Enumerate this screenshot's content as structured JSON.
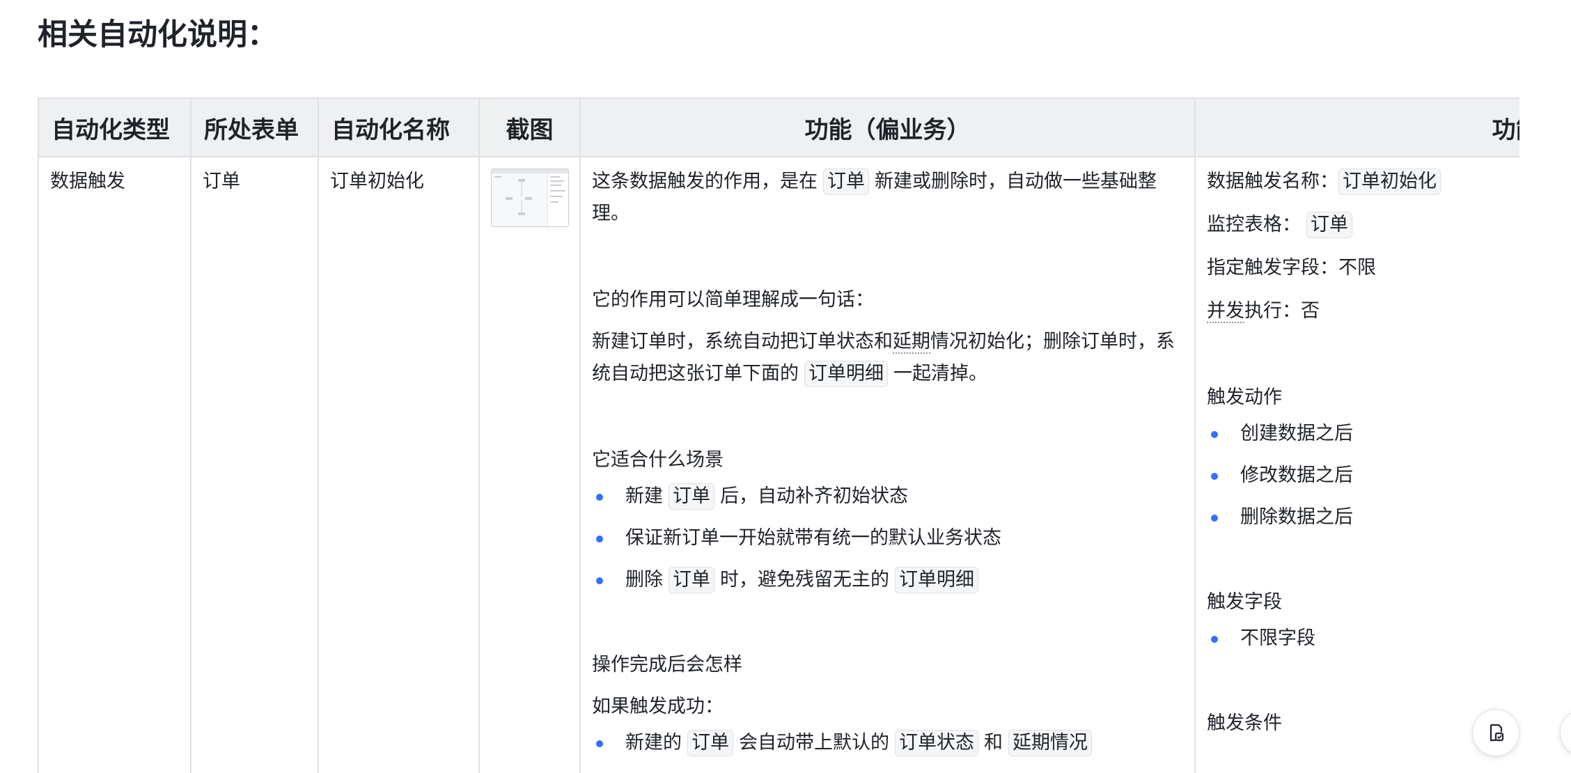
{
  "section_title": "相关自动化说明：",
  "table": {
    "headers": [
      "自动化类型",
      "所处表单",
      "自动化名称",
      "截图",
      "功能（偏业务）",
      "功能"
    ],
    "row": {
      "type": "数据触发",
      "sheet": "订单",
      "name": "订单初始化",
      "func": {
        "intro_pre": "这条数据触发的作用，是在",
        "intro_tag": "订单",
        "intro_post": "新建或删除时，自动做一些基础整理。",
        "summary_heading": "它的作用可以简单理解成一句话：",
        "summary_a": "新建订单时，系统自动把订单状态和",
        "summary_dotted": "延期",
        "summary_b": "情况初始化；删除订单时，系统自动把这张订单下面的",
        "summary_tag": "订单明细",
        "summary_c": "一起清掉。",
        "scenario_heading": "它适合什么场景",
        "scenario1_pre": "新建",
        "scenario1_tag": "订单",
        "scenario1_post": "后，自动补齐初始状态",
        "scenario2": "保证新订单一开始就带有统一的默认业务状态",
        "scenario3_pre": "删除",
        "scenario3_tag1": "订单",
        "scenario3_mid": "时，避免残留无主的",
        "scenario3_tag2": "订单明细",
        "after_heading": "操作完成后会怎样",
        "success_heading": "如果触发成功：",
        "success1_pre": "新建的",
        "success1_tag1": "订单",
        "success1_mid": "会自动带上默认的",
        "success1_tag2": "订单状态",
        "success1_and": "和",
        "success1_tag3": "延期情况"
      },
      "func2": {
        "trigger_name_label": "数据触发名称：",
        "trigger_name_value": "订单初始化",
        "monitor_label": "监控表格：",
        "monitor_value": "订单",
        "field_label": "指定触发字段：",
        "field_value": "不限",
        "concurrent_dotted": "并发",
        "concurrent_label": "执行：",
        "concurrent_value": "否",
        "action_heading": "触发动作",
        "actions": [
          "创建数据之后",
          "修改数据之后",
          "删除数据之后"
        ],
        "fields_heading": "触发字段",
        "fields": [
          "不限字段"
        ],
        "conditions_heading": "触发条件"
      }
    }
  },
  "floating": {
    "left_icon": "doc-check-icon",
    "right_icon": "help-circle-icon"
  },
  "colors": {
    "accent": "#3370ff",
    "header_bg": "#eff0f1",
    "border": "#dee0e3",
    "text": "#1f2329"
  }
}
